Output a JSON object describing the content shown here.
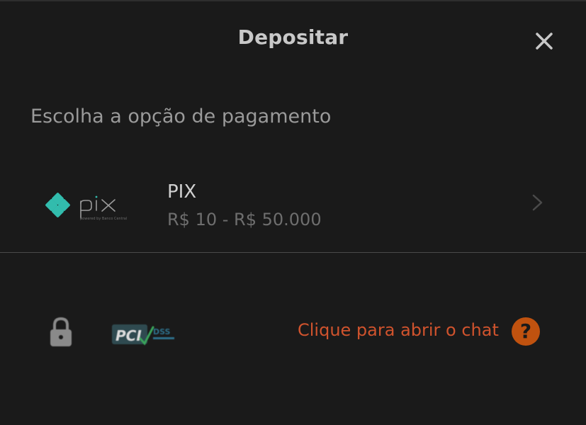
{
  "modal": {
    "title": "Depositar",
    "subtitle": "Escolha a opção de pagamento"
  },
  "payment_option": {
    "name": "PIX",
    "range": "R$ 10 - R$ 50.000",
    "logo_text": "pix",
    "logo_subtext": "powered by Banco Central",
    "icon": "pix-logo-icon"
  },
  "footer": {
    "chat_label": "Clique para abrir o chat",
    "help_symbol": "?",
    "pci_text": "PCI",
    "pci_dss": "DSS"
  },
  "colors": {
    "accent": "#d0532d",
    "help_bg": "#c0520f",
    "pix_teal": "#32bcad",
    "background": "#1a1a1a"
  }
}
